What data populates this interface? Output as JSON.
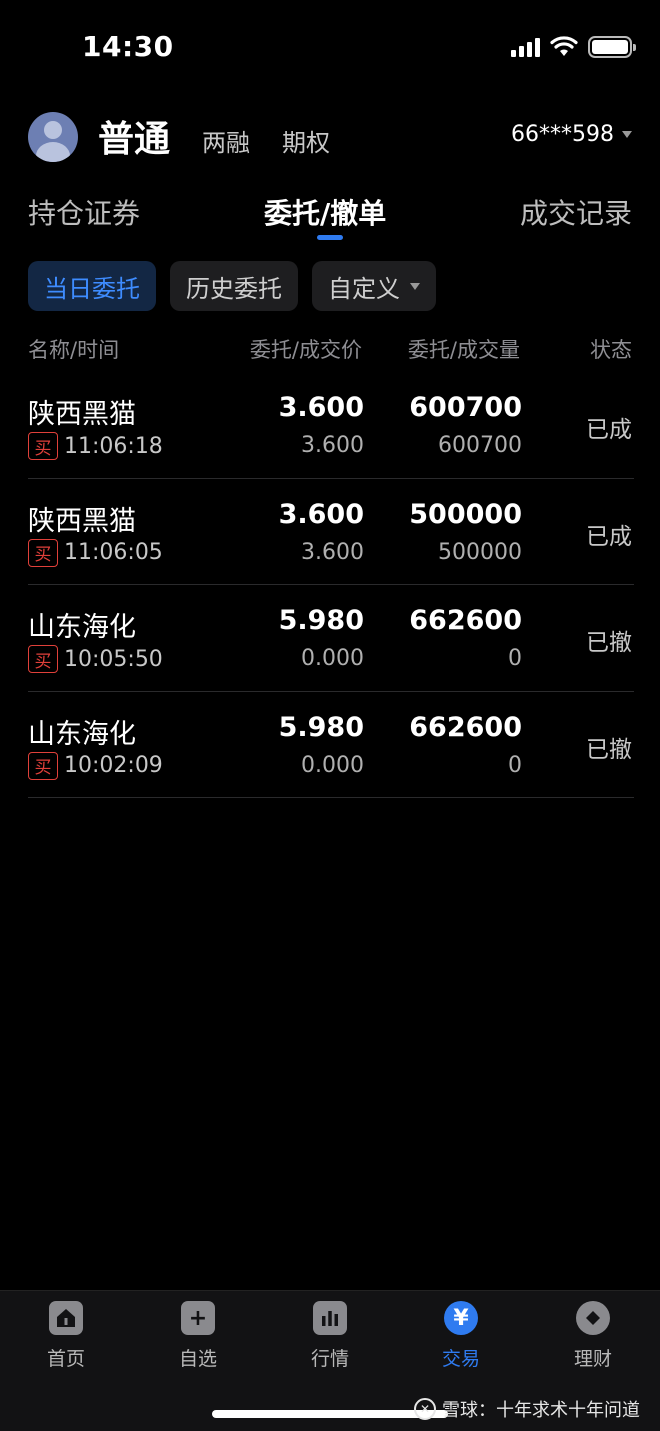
{
  "status_bar": {
    "time": "14:30",
    "icons": [
      "signal-icon",
      "wifi-icon",
      "battery-icon"
    ]
  },
  "account": {
    "types": [
      "普通",
      "两融",
      "期权"
    ],
    "selected_type": "普通",
    "account_number": "66***598"
  },
  "main_tabs": [
    {
      "label": "持仓证券"
    },
    {
      "label": "委托/撤单",
      "active": true
    },
    {
      "label": "成交记录"
    }
  ],
  "filters": [
    {
      "label": "当日委托",
      "active": true
    },
    {
      "label": "历史委托"
    },
    {
      "label": "自定义"
    }
  ],
  "table": {
    "headers": [
      "名称/时间",
      "委托/成交价",
      "委托/成交量",
      "状态"
    ],
    "rows": [
      {
        "name": "陕西黑猫",
        "side": "买",
        "time": "11:06:18",
        "price": "3.600",
        "deal_price": "3.600",
        "qty": "600700",
        "deal_qty": "600700",
        "status": "已成"
      },
      {
        "name": "陕西黑猫",
        "side": "买",
        "time": "11:06:05",
        "price": "3.600",
        "deal_price": "3.600",
        "qty": "500000",
        "deal_qty": "500000",
        "status": "已成"
      },
      {
        "name": "山东海化",
        "side": "买",
        "time": "10:05:50",
        "price": "5.980",
        "deal_price": "0.000",
        "qty": "662600",
        "deal_qty": "0",
        "status": "已撤"
      },
      {
        "name": "山东海化",
        "side": "买",
        "time": "10:02:09",
        "price": "5.980",
        "deal_price": "0.000",
        "qty": "662600",
        "deal_qty": "0",
        "status": "已撤"
      }
    ]
  },
  "bottom_nav": [
    {
      "label": "首页",
      "icon": "home-icon"
    },
    {
      "label": "自选",
      "icon": "plus-icon"
    },
    {
      "label": "行情",
      "icon": "chart-icon"
    },
    {
      "label": "交易",
      "icon": "yen-icon",
      "active": true
    },
    {
      "label": "理财",
      "icon": "diamond-icon"
    }
  ],
  "watermark": {
    "logo": "雪球",
    "text": "雪球：十年求术十年问道"
  },
  "colors": {
    "accent": "#2f7bf0",
    "buy": "#e0403a",
    "background": "#000000"
  }
}
